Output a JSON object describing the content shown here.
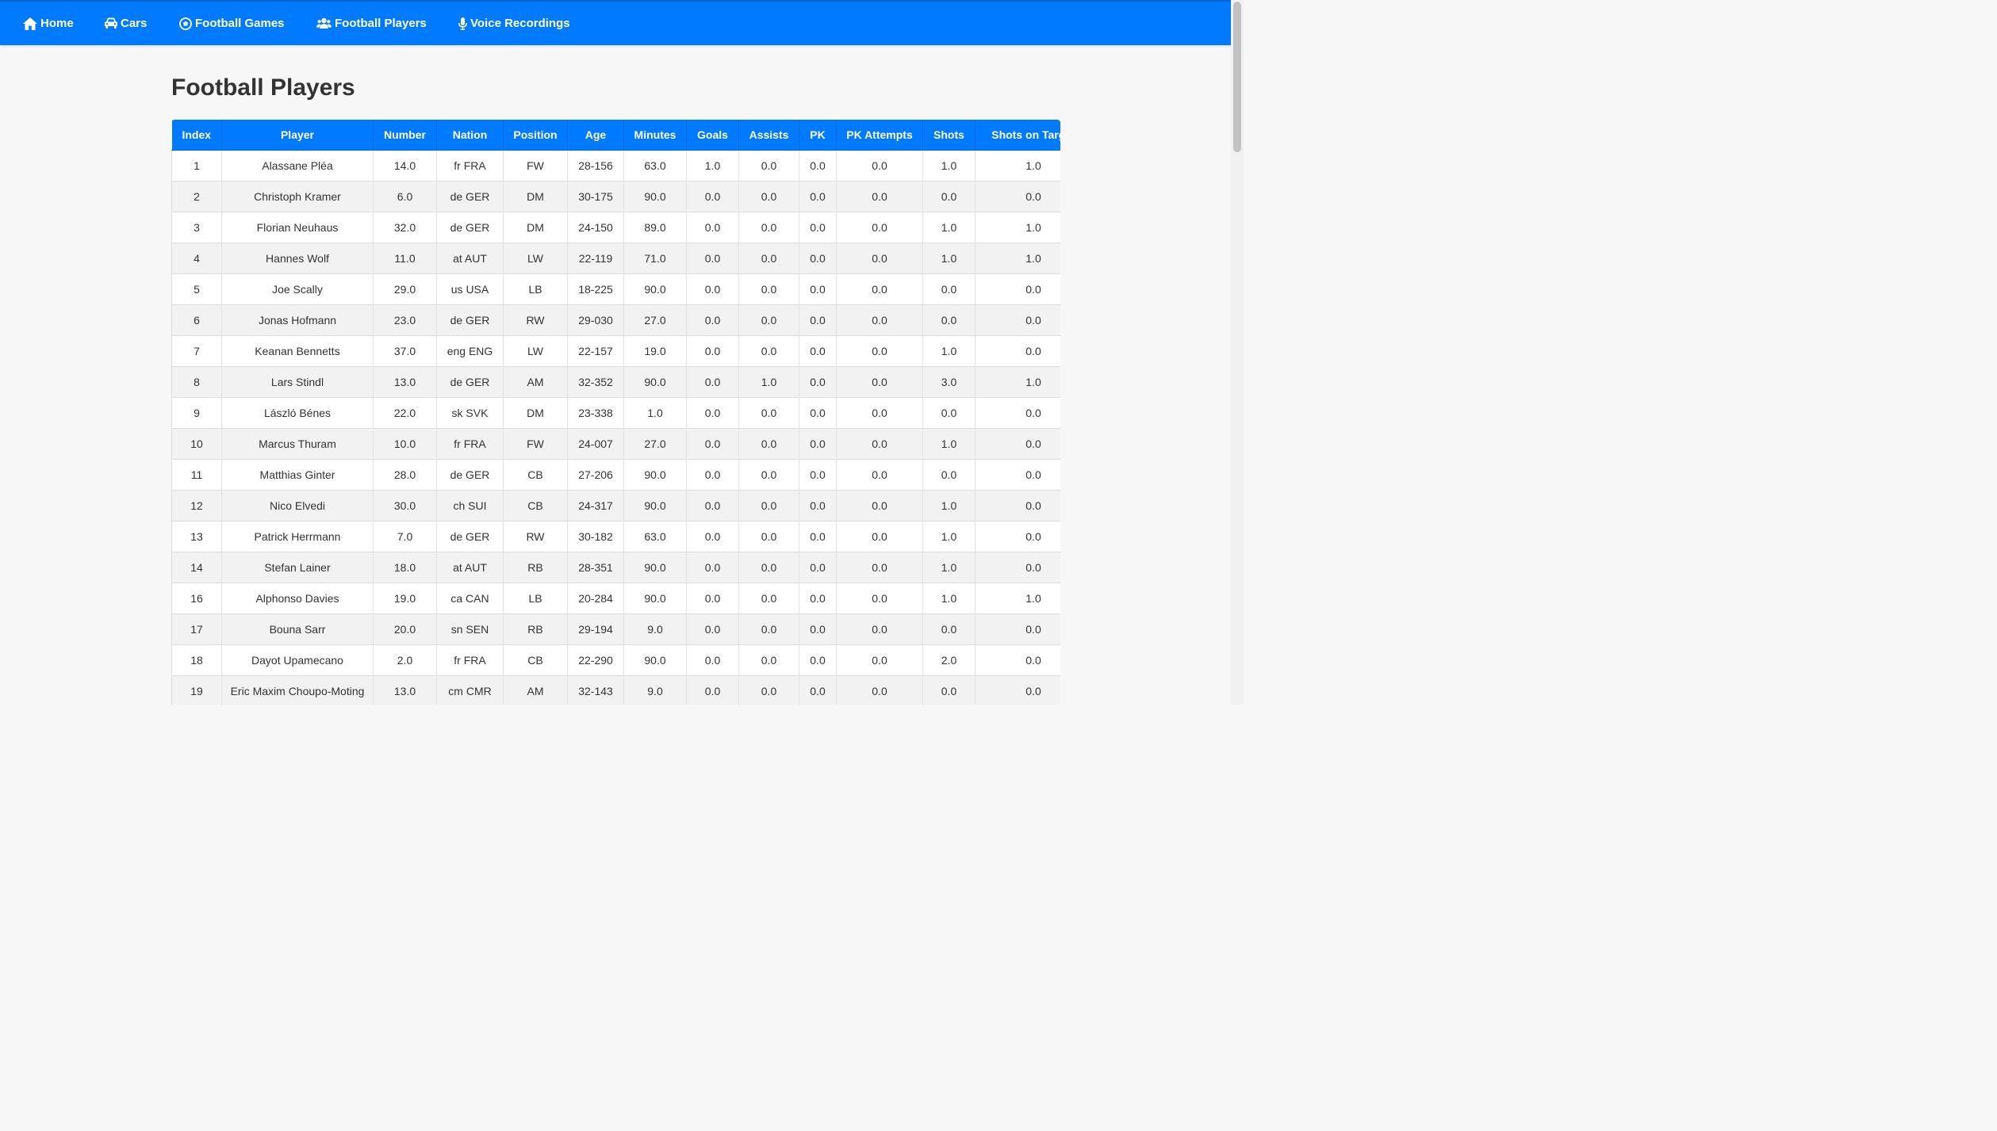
{
  "nav": {
    "home": "Home",
    "cars": "Cars",
    "football_games": "Football Games",
    "football_players": "Football Players",
    "voice_recordings": "Voice Recordings"
  },
  "page": {
    "title": "Football Players"
  },
  "colors": {
    "accent": "#007bff",
    "stripe": "#f2f2f2"
  },
  "table": {
    "headers": [
      "Index",
      "Player",
      "Number",
      "Nation",
      "Position",
      "Age",
      "Minutes",
      "Goals",
      "Assists",
      "PK",
      "PK Attempts",
      "Shots",
      "Shots on Target"
    ],
    "rows": [
      [
        "1",
        "Alassane Pléa",
        "14.0",
        "fr FRA",
        "FW",
        "28-156",
        "63.0",
        "1.0",
        "0.0",
        "0.0",
        "0.0",
        "1.0",
        "1.0"
      ],
      [
        "2",
        "Christoph Kramer",
        "6.0",
        "de GER",
        "DM",
        "30-175",
        "90.0",
        "0.0",
        "0.0",
        "0.0",
        "0.0",
        "0.0",
        "0.0"
      ],
      [
        "3",
        "Florian Neuhaus",
        "32.0",
        "de GER",
        "DM",
        "24-150",
        "89.0",
        "0.0",
        "0.0",
        "0.0",
        "0.0",
        "1.0",
        "1.0"
      ],
      [
        "4",
        "Hannes Wolf",
        "11.0",
        "at AUT",
        "LW",
        "22-119",
        "71.0",
        "0.0",
        "0.0",
        "0.0",
        "0.0",
        "1.0",
        "1.0"
      ],
      [
        "5",
        "Joe Scally",
        "29.0",
        "us USA",
        "LB",
        "18-225",
        "90.0",
        "0.0",
        "0.0",
        "0.0",
        "0.0",
        "0.0",
        "0.0"
      ],
      [
        "6",
        "Jonas Hofmann",
        "23.0",
        "de GER",
        "RW",
        "29-030",
        "27.0",
        "0.0",
        "0.0",
        "0.0",
        "0.0",
        "0.0",
        "0.0"
      ],
      [
        "7",
        "Keanan Bennetts",
        "37.0",
        "eng ENG",
        "LW",
        "22-157",
        "19.0",
        "0.0",
        "0.0",
        "0.0",
        "0.0",
        "1.0",
        "0.0"
      ],
      [
        "8",
        "Lars Stindl",
        "13.0",
        "de GER",
        "AM",
        "32-352",
        "90.0",
        "0.0",
        "1.0",
        "0.0",
        "0.0",
        "3.0",
        "1.0"
      ],
      [
        "9",
        "László Bénes",
        "22.0",
        "sk SVK",
        "DM",
        "23-338",
        "1.0",
        "0.0",
        "0.0",
        "0.0",
        "0.0",
        "0.0",
        "0.0"
      ],
      [
        "10",
        "Marcus Thuram",
        "10.0",
        "fr FRA",
        "FW",
        "24-007",
        "27.0",
        "0.0",
        "0.0",
        "0.0",
        "0.0",
        "1.0",
        "0.0"
      ],
      [
        "11",
        "Matthias Ginter",
        "28.0",
        "de GER",
        "CB",
        "27-206",
        "90.0",
        "0.0",
        "0.0",
        "0.0",
        "0.0",
        "0.0",
        "0.0"
      ],
      [
        "12",
        "Nico Elvedi",
        "30.0",
        "ch SUI",
        "CB",
        "24-317",
        "90.0",
        "0.0",
        "0.0",
        "0.0",
        "0.0",
        "1.0",
        "0.0"
      ],
      [
        "13",
        "Patrick Herrmann",
        "7.0",
        "de GER",
        "RW",
        "30-182",
        "63.0",
        "0.0",
        "0.0",
        "0.0",
        "0.0",
        "1.0",
        "0.0"
      ],
      [
        "14",
        "Stefan Lainer",
        "18.0",
        "at AUT",
        "RB",
        "28-351",
        "90.0",
        "0.0",
        "0.0",
        "0.0",
        "0.0",
        "1.0",
        "0.0"
      ],
      [
        "16",
        "Alphonso Davies",
        "19.0",
        "ca CAN",
        "LB",
        "20-284",
        "90.0",
        "0.0",
        "0.0",
        "0.0",
        "0.0",
        "1.0",
        "1.0"
      ],
      [
        "17",
        "Bouna Sarr",
        "20.0",
        "sn SEN",
        "RB",
        "29-194",
        "9.0",
        "0.0",
        "0.0",
        "0.0",
        "0.0",
        "0.0",
        "0.0"
      ],
      [
        "18",
        "Dayot Upamecano",
        "2.0",
        "fr FRA",
        "CB",
        "22-290",
        "90.0",
        "0.0",
        "0.0",
        "0.0",
        "0.0",
        "2.0",
        "0.0"
      ],
      [
        "19",
        "Eric Maxim Choupo-Moting",
        "13.0",
        "cm CMR",
        "AM",
        "32-143",
        "9.0",
        "0.0",
        "0.0",
        "0.0",
        "0.0",
        "0.0",
        "0.0"
      ]
    ]
  }
}
